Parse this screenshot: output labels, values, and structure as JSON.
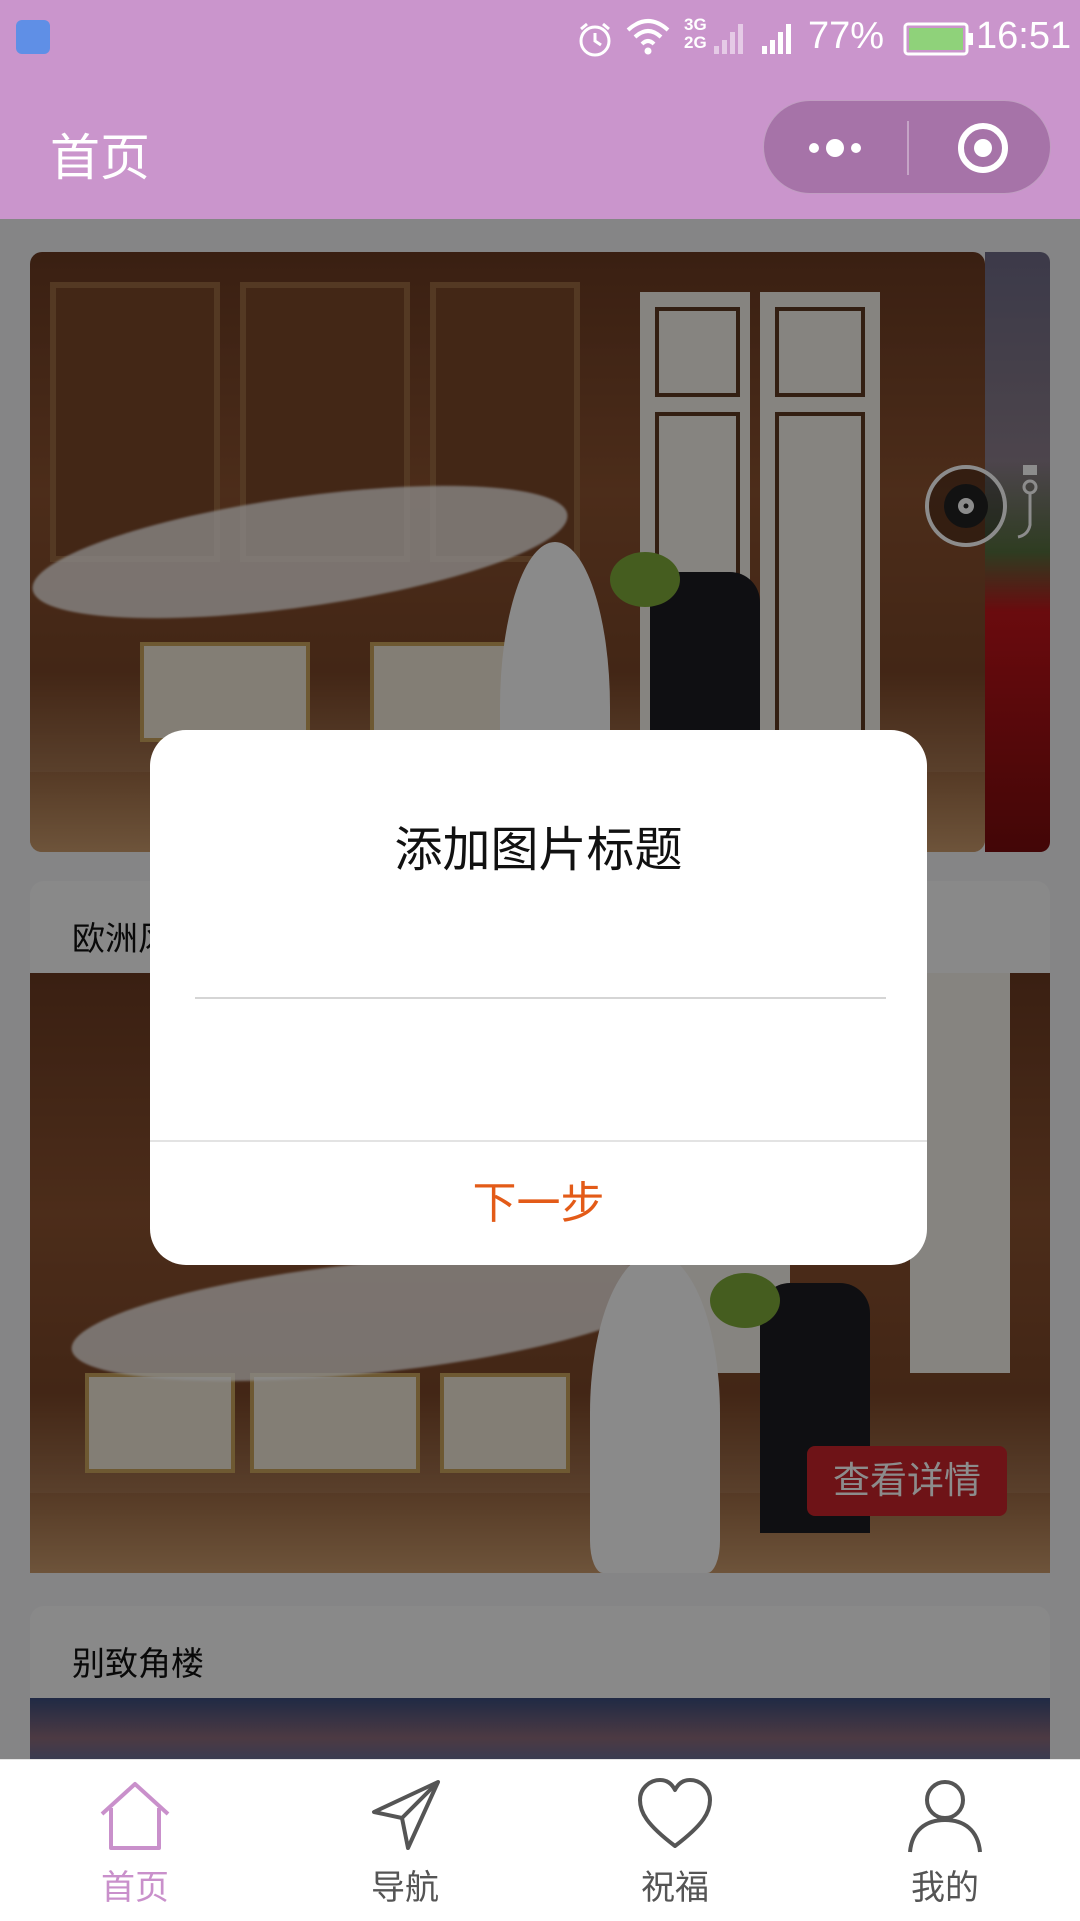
{
  "status_bar": {
    "network": "3G\n2G",
    "battery_pct": "77%",
    "time": "16:51"
  },
  "nav": {
    "title": "首页"
  },
  "cards": [
    {
      "label": "欧洲风情"
    },
    {
      "label": "别致角楼"
    }
  ],
  "detail_button": "查看详情",
  "dialog": {
    "title": "添加图片标题",
    "input_value": "",
    "next_label": "下一步"
  },
  "tabbar": {
    "items": [
      {
        "label": "首页",
        "icon": "home-icon",
        "active": true
      },
      {
        "label": "导航",
        "icon": "navigation-icon",
        "active": false
      },
      {
        "label": "祝福",
        "icon": "heart-icon",
        "active": false
      },
      {
        "label": "我的",
        "icon": "user-icon",
        "active": false
      }
    ]
  },
  "colors": {
    "brand": "#ca95cc",
    "accent": "#e35b18",
    "detail_button": "#c8232a",
    "fab": "#b97ab9"
  }
}
